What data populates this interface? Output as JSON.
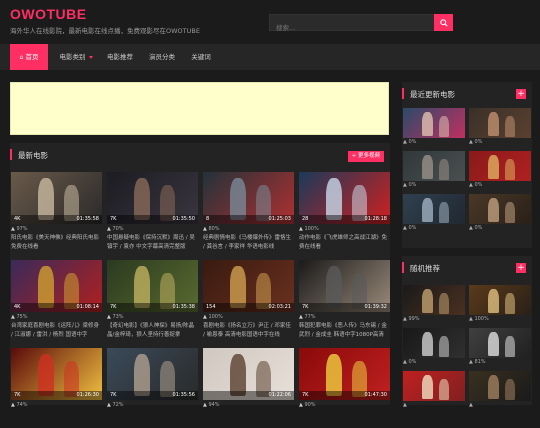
{
  "site": {
    "logo": "OWOTUBE",
    "tagline": "海外华人在线影院，最新电影在线点播，免费观影尽在OWOTUBE"
  },
  "search": {
    "placeholder": "搜索..."
  },
  "nav": [
    {
      "label": "首页",
      "active": true
    },
    {
      "label": "电影类别",
      "dropdown": true
    },
    {
      "label": "电影推荐"
    },
    {
      "label": "演员分类"
    },
    {
      "label": "关键词"
    }
  ],
  "latest": {
    "title": "最新电影",
    "more_label": "+ 更多视频",
    "cards": [
      {
        "views": "4K",
        "duration": "01:35:58",
        "rating": "97%",
        "title": "阳氏电影《美天神佛》经典阳氏电影免费在线看",
        "colors": [
          "#6a5a4a",
          "#c9b9a0",
          "#2a2a2a"
        ]
      },
      {
        "views": "7K",
        "duration": "01:35:50",
        "rating": "70%",
        "title": "中国悬疑电影《保持沉默》周迅 / 吴镇宇 / 袁亦 中文字幕高清完整版",
        "colors": [
          "#1c1c22",
          "#8a6a5a",
          "#3a3540"
        ]
      },
      {
        "views": "8",
        "duration": "01:25:03",
        "rating": "80%",
        "title": "经典剧情电影《马楼爆外传》雷恪生 / 龚谷言 / 李家祥 华语电影线",
        "colors": [
          "#22323a",
          "#7a8a98",
          "#b03030"
        ]
      },
      {
        "views": "28",
        "duration": "01:28:18",
        "rating": "100%",
        "title": "动作电影《飞虎雄师之高战江湖》免费在线看",
        "colors": [
          "#1a3a5a",
          "#c8d8e8",
          "#d02020"
        ]
      },
      {
        "views": "4K",
        "duration": "01:08:14",
        "rating": "75%",
        "title": "台湾家庭喜剧电影《运阵儿》梁修身 / 江淑娜 / 雷洪 / 杨烈 国语中字",
        "colors": [
          "#3a2a5a",
          "#d0a030",
          "#b02020"
        ]
      },
      {
        "views": "7K",
        "duration": "01:35:38",
        "rating": "73%",
        "title": "【奇幻电影】《狼人神探》易扬/陈晶晶/金梓琦，狼人坚持行善捉拿",
        "colors": [
          "#2a3a20",
          "#c0b060",
          "#5a6a30"
        ]
      },
      {
        "views": "154",
        "duration": "02:03:21",
        "rating": "100%",
        "title": "喜剧电影《扬名立万》尹正 / 邓家佳 / 喻恩泰 高清电影国语中字在线",
        "colors": [
          "#3a1a10",
          "#d0a050",
          "#6a3020"
        ]
      },
      {
        "views": "7K",
        "duration": "01:39:32",
        "rating": "77%",
        "title": "韩国犯罪电影《恶人传》马东锡 / 金武烈 / 金成圭 韩语中字1080P高清",
        "colors": [
          "#1a1a1a",
          "#5a5a5a",
          "#9a8a7a"
        ]
      },
      {
        "views": "7K",
        "duration": "01:26:30",
        "rating": "74%",
        "title": "",
        "colors": [
          "#5a0a0a",
          "#d03020",
          "#f0c040"
        ]
      },
      {
        "views": "7K",
        "duration": "01:35:56",
        "rating": "72%",
        "title": "",
        "colors": [
          "#3a4a5a",
          "#b0a090",
          "#2a2a2a"
        ]
      },
      {
        "views": "",
        "duration": "01:22:06",
        "rating": "94%",
        "title": "",
        "colors": [
          "#d0c8c0",
          "#5a4030",
          "#e8e0d8"
        ]
      },
      {
        "views": "7K",
        "duration": "01:47:30",
        "rating": "90%",
        "title": "",
        "colors": [
          "#8a0a0a",
          "#f0d040",
          "#c02020"
        ]
      }
    ]
  },
  "recent_side": {
    "title": "最近更新电影",
    "plus": "+",
    "cards": [
      {
        "rating": "0%",
        "colors": [
          "#2a4a6a",
          "#e0c0b0",
          "#c03060"
        ]
      },
      {
        "rating": "0%",
        "colors": [
          "#3a3028",
          "#c09070",
          "#5a4030"
        ]
      },
      {
        "rating": "0%",
        "colors": [
          "#30383a",
          "#9a9088",
          "#4a5050"
        ]
      },
      {
        "rating": "0%",
        "colors": [
          "#8a1a1a",
          "#e0b060",
          "#b02020"
        ]
      },
      {
        "rating": "0%",
        "colors": [
          "#304050",
          "#a0b0c0",
          "#202830"
        ]
      },
      {
        "rating": "0%",
        "colors": [
          "#4a3828",
          "#c0a080",
          "#2a2018"
        ]
      }
    ]
  },
  "random_side": {
    "title": "随机推荐",
    "plus": "+",
    "cards": [
      {
        "rating": "99%",
        "colors": [
          "#1a1a1a",
          "#c0a070",
          "#4a3020"
        ]
      },
      {
        "rating": "100%",
        "colors": [
          "#5a3a1a",
          "#e0c080",
          "#2a2018"
        ]
      },
      {
        "rating": "0%",
        "colors": [
          "#181818",
          "#d0d0d0",
          "#303030"
        ]
      },
      {
        "rating": "81%",
        "colors": [
          "#404040",
          "#e0e0e0",
          "#202020"
        ]
      },
      {
        "rating": "",
        "colors": [
          "#c02020",
          "#f0e0c0",
          "#802020"
        ]
      },
      {
        "rating": "",
        "colors": [
          "#3a3020",
          "#a08060",
          "#1a1a1a"
        ]
      }
    ]
  },
  "colors": {
    "accent": "#ff2e63",
    "bg": "#1b1b1b",
    "panel": "#232323",
    "ad": "#ffffcc"
  }
}
